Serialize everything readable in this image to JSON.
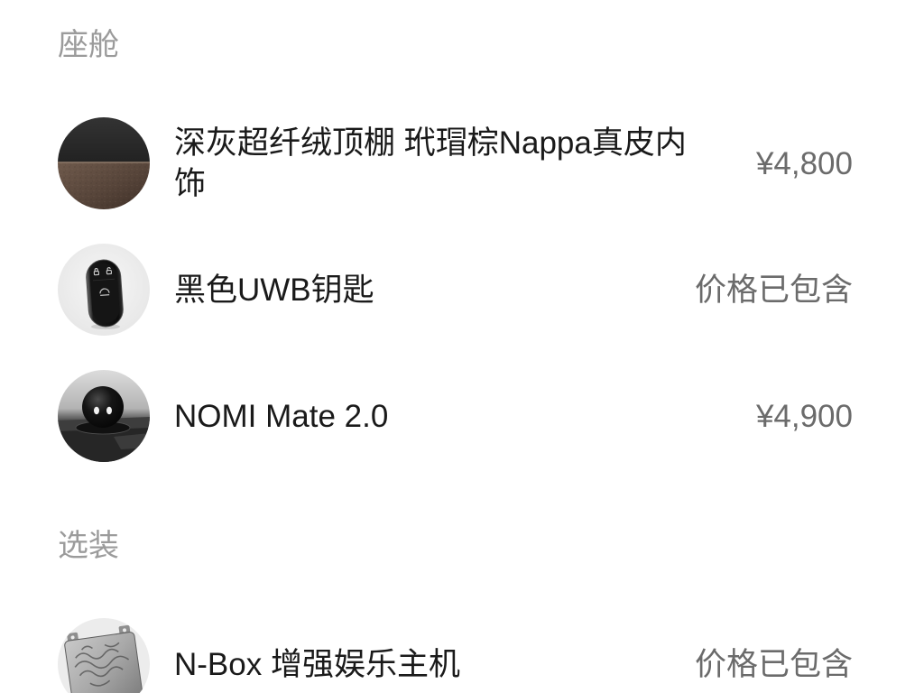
{
  "sections": [
    {
      "title": "座舱",
      "items": [
        {
          "title": "深灰超纤绒顶棚 玳瑁棕Nappa真皮内饰",
          "price": "¥4,800",
          "thumbnail": "interior-swatch-image"
        },
        {
          "title": "黑色UWB钥匙",
          "price": "价格已包含",
          "thumbnail": "uwb-key-image"
        },
        {
          "title": "NOMI Mate 2.0",
          "price": "¥4,900",
          "thumbnail": "nomi-mate-image"
        }
      ]
    },
    {
      "title": "选装",
      "items": [
        {
          "title": "N-Box 增强娱乐主机",
          "price": "价格已包含",
          "thumbnail": "n-box-image"
        }
      ]
    }
  ],
  "colors": {
    "background": "#ffffff",
    "section_title": "#9b9b9b",
    "item_title": "#1a1a1a",
    "price": "#6b6b6b"
  }
}
